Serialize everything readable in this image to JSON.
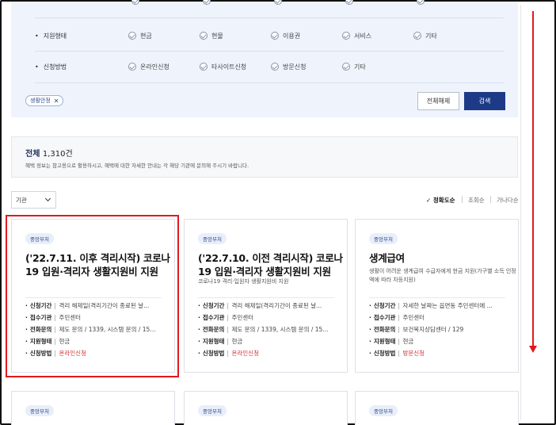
{
  "filters": {
    "top_row": {
      "options": [
        "",
        "",
        "",
        "",
        ""
      ]
    },
    "support_type": {
      "label": "지원형태",
      "options": [
        "현금",
        "현물",
        "이용권",
        "서비스",
        "기타"
      ]
    },
    "apply_method": {
      "label": "신청방법",
      "options": [
        "온라인신청",
        "타사이트신청",
        "방문신청",
        "기타"
      ]
    },
    "selected_tag": {
      "label": "생활안정",
      "remove_icon": "✕"
    },
    "reset_label": "전체해제",
    "search_label": "검색"
  },
  "summary": {
    "title": "전체",
    "count": "1,310건",
    "description": "혜택 정보는 참고용으로 활용하시고, 혜택에 대한 자세한 안내는 각 해당 기관에 문의해 주시기 바랍니다."
  },
  "sort_bar": {
    "select_value": "기관",
    "options": [
      {
        "label": "✓ 정확도순",
        "active": true
      },
      {
        "label": "조회순",
        "active": false
      },
      {
        "label": "가나다순",
        "active": false
      }
    ]
  },
  "cards": [
    {
      "badge": "중앙부처",
      "title": "('22.7.11. 이후 격리시작) 코로나19 입원·격리자 생활지원비 지원",
      "subtitle": "",
      "rows": [
        {
          "key": "신청기간",
          "value": "격리 해제일(격리기간이 종료된 날..."
        },
        {
          "key": "접수기관",
          "value": "주민센터"
        },
        {
          "key": "전화문의",
          "value": "제도 문의 / 1339, 시스템 문의 / 15..."
        },
        {
          "key": "지원형태",
          "value": "현금"
        },
        {
          "key": "신청방법",
          "value": "온라인신청"
        }
      ]
    },
    {
      "badge": "중앙부처",
      "title": "('22.7.10. 이전 격리시작) 코로나19 입원·격리자 생활지원비 지원",
      "subtitle": "코로나19 격리·입원자 생활지원비 지원",
      "rows": [
        {
          "key": "신청기간",
          "value": "격리 해제일(격리기간이 종료된 날..."
        },
        {
          "key": "접수기관",
          "value": "주민센터"
        },
        {
          "key": "전화문의",
          "value": "제도 문의 / 1339, 시스템 문의 / 15..."
        },
        {
          "key": "지원형태",
          "value": "현금"
        },
        {
          "key": "신청방법",
          "value": "온라인신청"
        }
      ]
    },
    {
      "badge": "중앙부처",
      "title": "생계급여",
      "subtitle": "생활이 어려운 생계급여 수급자에게 현금 지원(가구별 소득 인정액에 따라 차등지원)",
      "rows": [
        {
          "key": "신청기간",
          "value": "자세한 날짜는 읍면동 주민센터에 ..."
        },
        {
          "key": "접수기관",
          "value": "주민센터"
        },
        {
          "key": "전화문의",
          "value": "보건복지상담센터 / 129"
        },
        {
          "key": "지원형태",
          "value": "현금"
        },
        {
          "key": "신청방법",
          "value": "방문신청"
        }
      ]
    },
    {
      "badge": "중앙부처"
    },
    {
      "badge": "중앙부처"
    },
    {
      "badge": "중앙부처"
    }
  ]
}
